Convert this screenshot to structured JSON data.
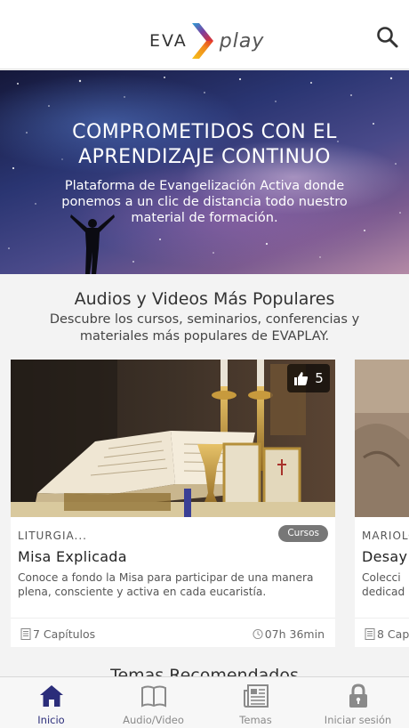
{
  "header": {
    "logo_left": "EVA",
    "logo_right": "play",
    "search_icon": "search-icon"
  },
  "hero": {
    "title_line1": "COMPROMETIDOS CON EL",
    "title_line2": "APRENDIZAJE CONTINUO",
    "subtitle": "Plataforma de Evangelización Activa donde ponemos a un clic de distancia todo nuestro material de formación."
  },
  "popular": {
    "title": "Audios y Videos Más Populares",
    "subtitle": "Descubre los cursos, seminarios, conferencias y materiales más populares de EVAPLAY."
  },
  "cards": [
    {
      "likes": "5",
      "category": "LITURGIA...",
      "badge": "Cursos",
      "title": "Misa Explicada",
      "description": "Conoce a fondo la Misa para participar de una manera plena, consciente y activa en cada eucaristía.",
      "chapters": "7 Capítulos",
      "duration": "07h 36min"
    },
    {
      "category": "MARIOLO",
      "title": "Desay",
      "description_line1": "Colecci",
      "description_line2": "dedicad",
      "chapters": "8 Cap"
    }
  ],
  "next_section": {
    "title": "Temas Recomendados"
  },
  "tabbar": {
    "tabs": [
      {
        "label": "Inicio",
        "icon": "home-icon",
        "active": true
      },
      {
        "label": "Audio/Video",
        "icon": "book-icon",
        "active": false
      },
      {
        "label": "Temas",
        "icon": "newspaper-icon",
        "active": false
      },
      {
        "label": "Iniciar sesión",
        "icon": "lock-icon",
        "active": false
      }
    ]
  },
  "colors": {
    "accent": "#2b2d7a",
    "inactive": "#8a8a8a",
    "badge": "#777777"
  }
}
